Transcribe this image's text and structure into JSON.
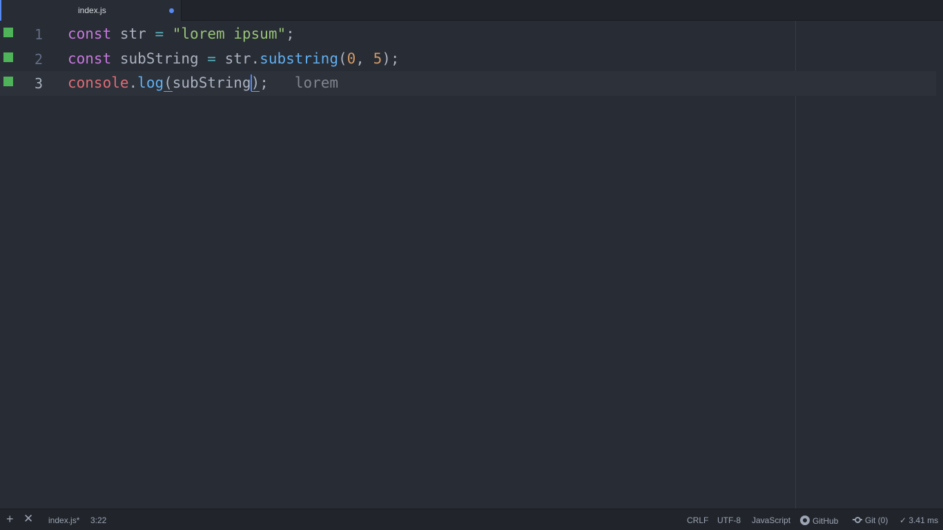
{
  "tab": {
    "title": "index.js"
  },
  "editor": {
    "lines": [
      {
        "number": "1",
        "tokens": [
          "const",
          " str ",
          "=",
          " ",
          "\"lorem ipsum\"",
          ";"
        ]
      },
      {
        "number": "2",
        "tokens": [
          "const",
          " subString ",
          "=",
          " str.",
          "substring",
          "(",
          "0",
          ", ",
          "5",
          ");"
        ]
      },
      {
        "number": "3",
        "tokens": [
          "console",
          ".",
          "log",
          "(",
          "subString",
          ")",
          ";",
          "lorem"
        ]
      }
    ]
  },
  "statusbar": {
    "file": "index.js*",
    "cursor": "3:22",
    "line_ending": "CRLF",
    "encoding": "UTF-8",
    "grammar": "JavaScript",
    "github": "GitHub",
    "git": "Git (0)",
    "timing": "✓ 3.41 ms"
  },
  "colors": {
    "background": "#282c34",
    "accent": "#568af2",
    "git_added": "#4fb35a"
  },
  "icons": {
    "add": "plus-icon",
    "close": "close-icon",
    "github": "github-icon",
    "git": "git-commit-icon",
    "modified": "modified-dot-icon"
  }
}
